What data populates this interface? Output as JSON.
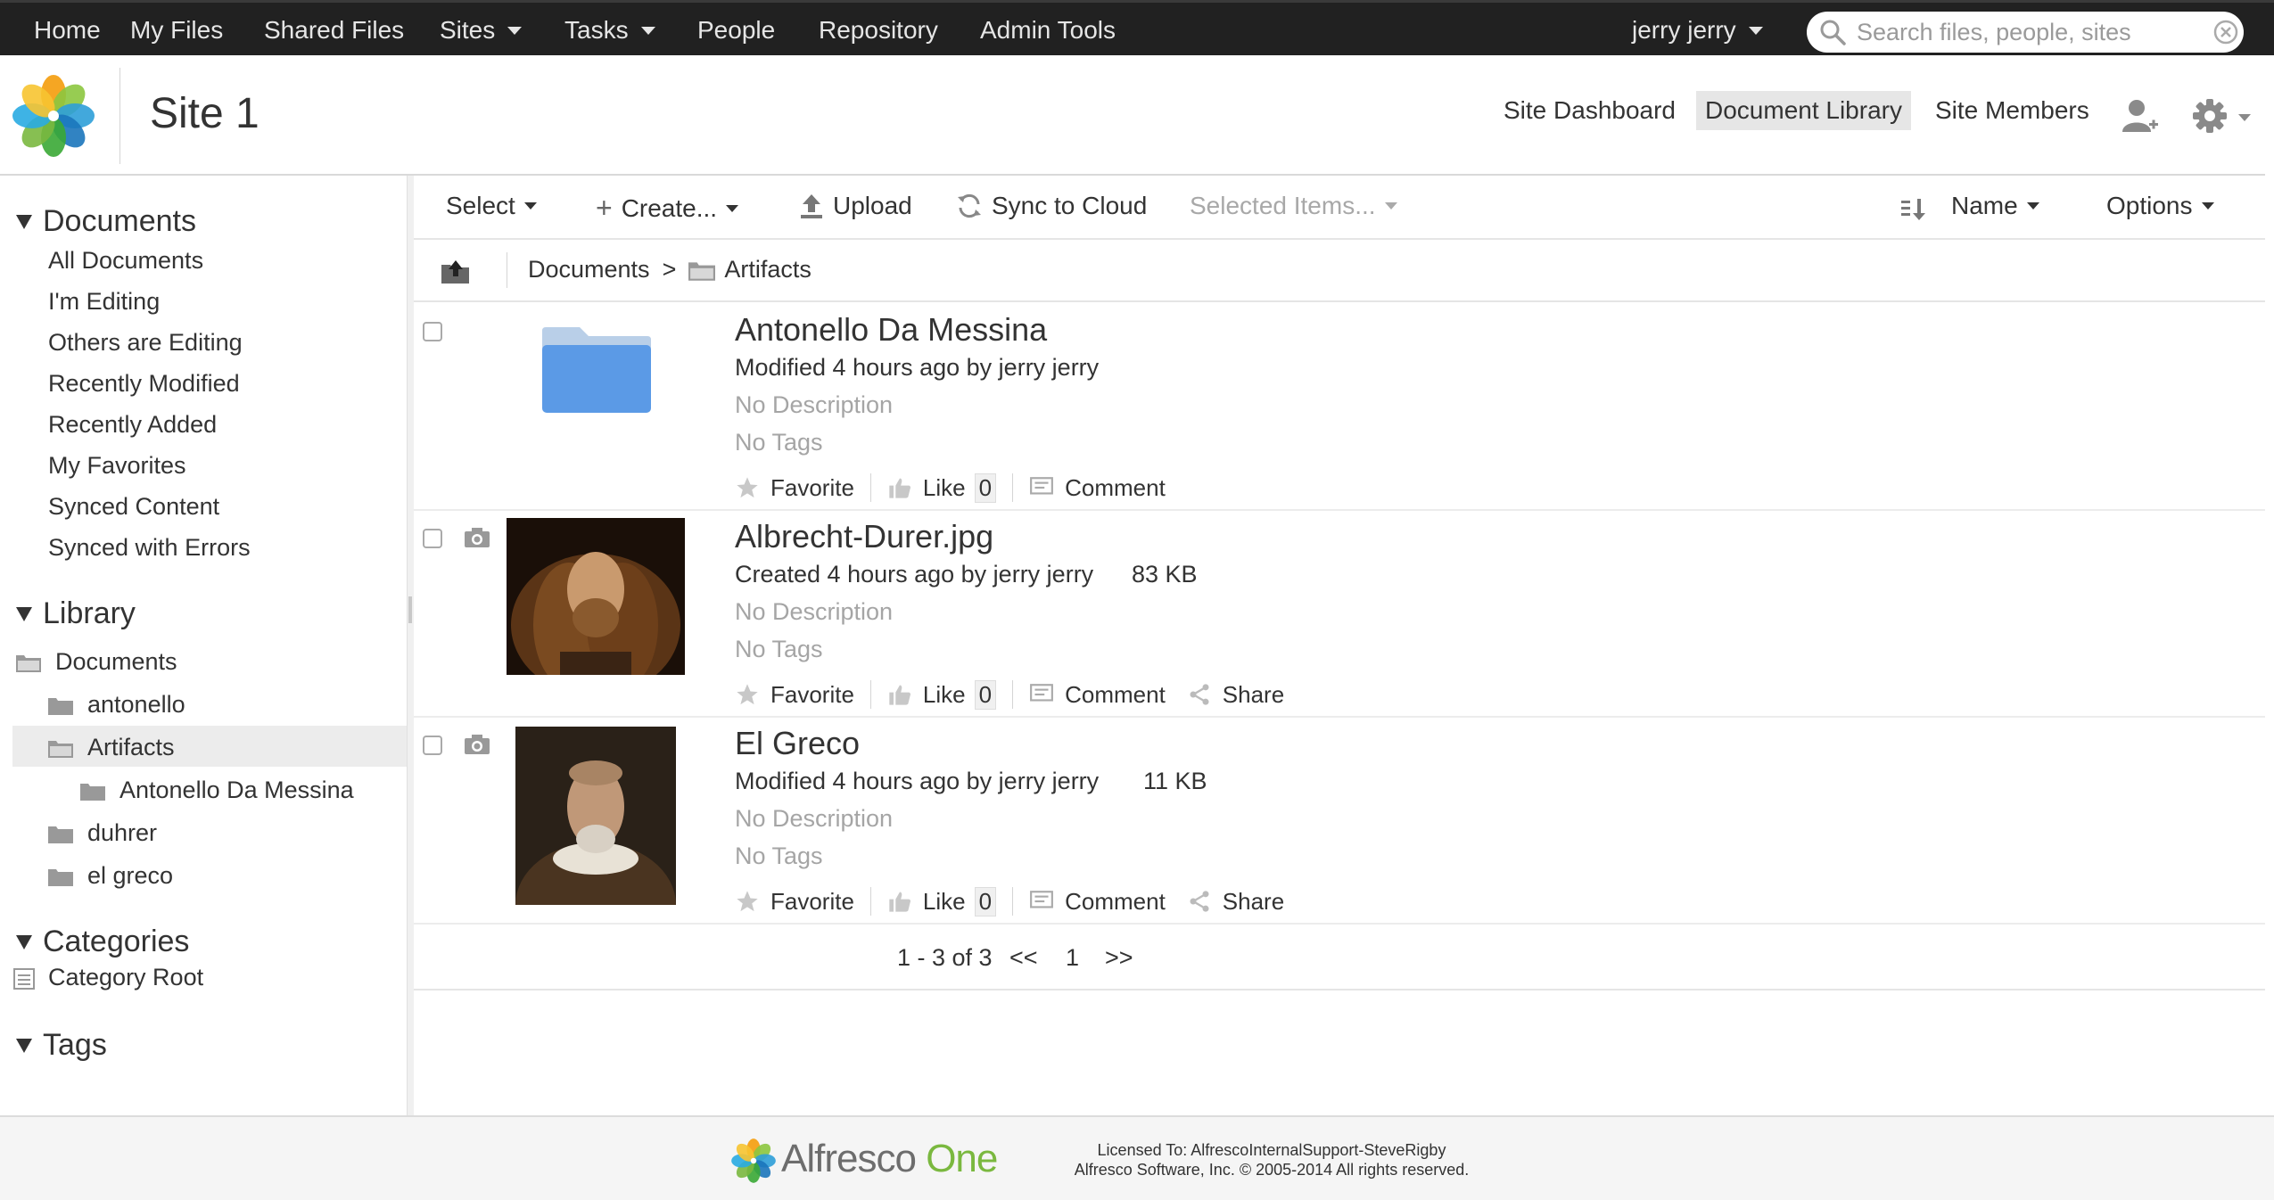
{
  "topnav": {
    "home": "Home",
    "my_files": "My Files",
    "shared_files": "Shared Files",
    "sites": "Sites",
    "tasks": "Tasks",
    "people": "People",
    "repository": "Repository",
    "admin_tools": "Admin Tools",
    "user": "jerry jerry",
    "search_placeholder": "Search files, people, sites"
  },
  "site": {
    "title": "Site 1",
    "nav": {
      "dashboard": "Site Dashboard",
      "doclib": "Document Library",
      "members": "Site Members"
    }
  },
  "sidebar": {
    "documents_heading": "Documents",
    "documents_links": [
      "All Documents",
      "I'm Editing",
      "Others are Editing",
      "Recently Modified",
      "Recently Added",
      "My Favorites",
      "Synced Content",
      "Synced with Errors"
    ],
    "library_heading": "Library",
    "tree": {
      "root": "Documents",
      "antonello": "antonello",
      "artifacts": "Artifacts",
      "antonello_da_messina": "Antonello Da Messina",
      "duhrer": "duhrer",
      "el_greco": "el greco"
    },
    "categories_heading": "Categories",
    "category_root": "Category Root",
    "tags_heading": "Tags"
  },
  "toolbar": {
    "select": "Select",
    "create": "Create...",
    "upload": "Upload",
    "sync": "Sync to Cloud",
    "selected_items": "Selected Items...",
    "sort": "Name",
    "options": "Options"
  },
  "path": {
    "root": "Documents",
    "sep": ">",
    "current": "Artifacts"
  },
  "rows": [
    {
      "name": "Antonello Da Messina",
      "meta": "Modified 4 hours ago by jerry jerry",
      "size": "",
      "desc": "No Description",
      "tags": "No Tags",
      "favorite": "Favorite",
      "like": "Like",
      "likes": "0",
      "comment": "Comment",
      "share": ""
    },
    {
      "name": "Albrecht-Durer.jpg",
      "meta": "Created 4 hours ago by jerry jerry",
      "size": "83 KB",
      "desc": "No Description",
      "tags": "No Tags",
      "favorite": "Favorite",
      "like": "Like",
      "likes": "0",
      "comment": "Comment",
      "share": "Share"
    },
    {
      "name": "El Greco",
      "meta": "Modified 4 hours ago by jerry jerry",
      "size": "11 KB",
      "desc": "No Description",
      "tags": "No Tags",
      "favorite": "Favorite",
      "like": "Like",
      "likes": "0",
      "comment": "Comment",
      "share": "Share"
    }
  ],
  "pager": {
    "range": "1 - 3 of 3",
    "prev": "<<",
    "page": "1",
    "next": ">>"
  },
  "footer": {
    "brand": "Alfresco",
    "brand_suffix": "One",
    "license_line1": "Licensed To: AlfrescoInternalSupport-SteveRigby",
    "license_line2": "Alfresco Software, Inc. © 2005-2014 All rights reserved."
  },
  "colors": {
    "topbar": "#212121",
    "folder_blue": "#5b9ae6",
    "brand_green": "#7ab83f"
  }
}
